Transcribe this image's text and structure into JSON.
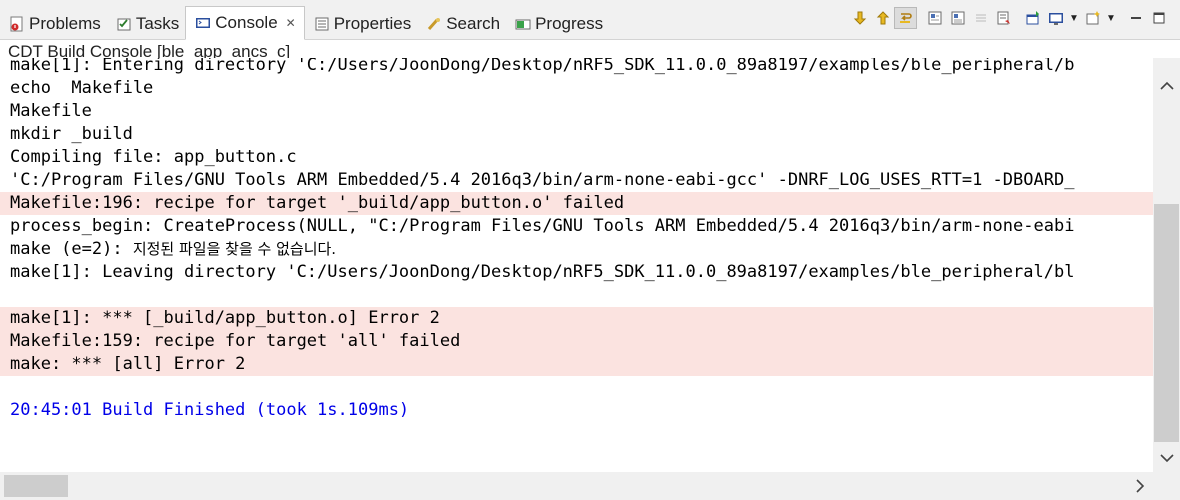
{
  "tabs": [
    {
      "label": "Problems",
      "icon": "problems-icon"
    },
    {
      "label": "Tasks",
      "icon": "tasks-icon"
    },
    {
      "label": "Console",
      "icon": "console-icon",
      "active": true,
      "close": "✕"
    },
    {
      "label": "Properties",
      "icon": "properties-icon"
    },
    {
      "label": "Search",
      "icon": "search-icon"
    },
    {
      "label": "Progress",
      "icon": "progress-icon"
    }
  ],
  "toolbar": {
    "icons": [
      "scroll-lock-icon",
      "show-next-console-icon",
      "word-wrap-icon",
      "clear-console-icon",
      "copy-output-icon",
      "pin-console-icon",
      "display-selected-console-icon",
      "open-console-icon",
      "minimize-icon",
      "maximize-icon"
    ]
  },
  "console": {
    "title": "CDT Build Console [ble_app_ancs_c]",
    "lines": [
      {
        "text": "make[1]: Entering directory 'C:/Users/JoonDong/Desktop/nRF5_SDK_11.0.0_89a8197/examples/ble_peripheral/b",
        "type": "normal"
      },
      {
        "text": "echo  Makefile",
        "type": "normal"
      },
      {
        "text": "Makefile",
        "type": "normal"
      },
      {
        "text": "mkdir _build",
        "type": "normal"
      },
      {
        "text": "Compiling file: app_button.c",
        "type": "normal"
      },
      {
        "text": "'C:/Program Files/GNU Tools ARM Embedded/5.4 2016q3/bin/arm-none-eabi-gcc' -DNRF_LOG_USES_RTT=1 -DBOARD_",
        "type": "normal"
      },
      {
        "text": "Makefile:196: recipe for target '_build/app_button.o' failed",
        "type": "err"
      },
      {
        "text": "process_begin: CreateProcess(NULL, \"C:/Program Files/GNU Tools ARM Embedded/5.4 2016q3/bin/arm-none-eabi",
        "type": "normal"
      },
      {
        "text": "make (e=2): ",
        "suffix": "지정된 파일을 찾을 수 없습니다.",
        "type": "normal"
      },
      {
        "text": "make[1]: Leaving directory 'C:/Users/JoonDong/Desktop/nRF5_SDK_11.0.0_89a8197/examples/ble_peripheral/bl",
        "type": "normal"
      },
      {
        "text": "",
        "type": "blank"
      },
      {
        "text": "make[1]: *** [_build/app_button.o] Error 2",
        "type": "err"
      },
      {
        "text": "Makefile:159: recipe for target 'all' failed",
        "type": "err"
      },
      {
        "text": "make: *** [all] Error 2",
        "type": "err"
      },
      {
        "text": "",
        "type": "blank"
      },
      {
        "text": "20:45:01 Build Finished (took 1s.109ms)",
        "type": "finish"
      }
    ]
  },
  "scrollbars": {
    "vertical": {
      "up_icon": "chevron-up-icon",
      "down_icon": "chevron-down-icon"
    },
    "horizontal": {
      "right_icon": "chevron-right-icon"
    }
  }
}
